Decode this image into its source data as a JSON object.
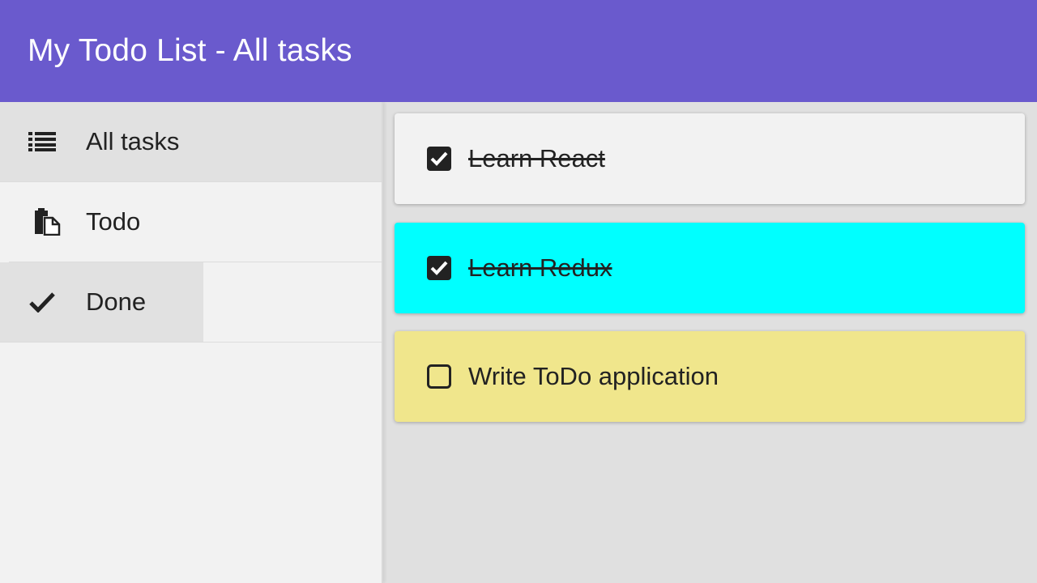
{
  "header": {
    "title": "My Todo List - All tasks",
    "color": "#6a5acd"
  },
  "sidebar": {
    "items": [
      {
        "label": "All tasks",
        "icon": "list-icon",
        "active": true
      },
      {
        "label": "Todo",
        "icon": "clipboard-icon",
        "active": false
      },
      {
        "label": "Done",
        "icon": "check-icon",
        "active": false
      }
    ]
  },
  "tasks": [
    {
      "text": "Learn React",
      "done": true,
      "color": "#f2f2f2"
    },
    {
      "text": "Learn Redux",
      "done": true,
      "color": "#00ffff"
    },
    {
      "text": "Write ToDo application",
      "done": false,
      "color": "#f0e68c"
    }
  ]
}
